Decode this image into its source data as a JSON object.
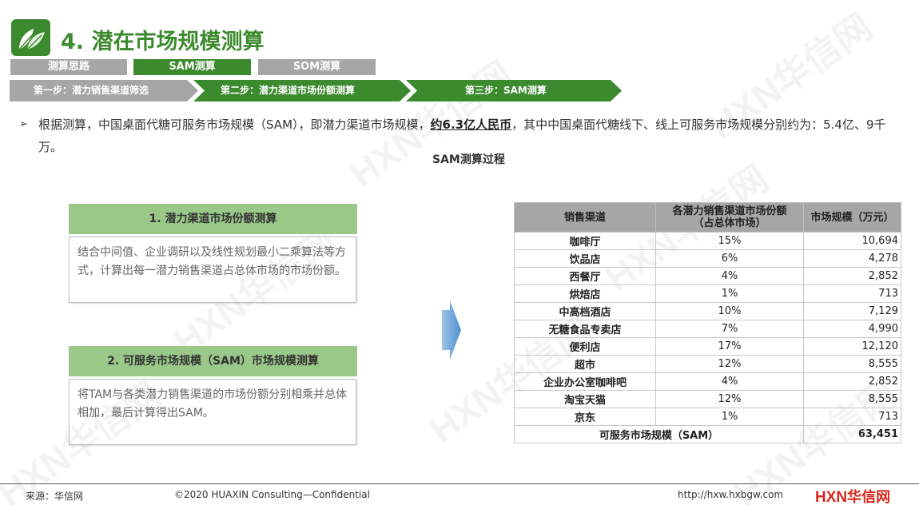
{
  "header": {
    "title": "4. 潜在市场规模测算",
    "tabs": [
      {
        "label": "测算思路",
        "active": false
      },
      {
        "label": "SAM测算",
        "active": true
      },
      {
        "label": "SOM测算",
        "active": false
      }
    ],
    "steps": [
      {
        "label": "第一步：潜力销售渠道筛选",
        "color": "#a6a6a6"
      },
      {
        "label": "第二步：潜力渠道市场份额测算",
        "color": "#3c8a2e"
      },
      {
        "label": "第三步：SAM测算",
        "color": "#3c8a2e"
      }
    ]
  },
  "summary": {
    "pre": "根据测算，中国桌面代糖可服务市场规模（SAM），即潜力渠道市场规模，",
    "highlight": "约6.3亿人民币",
    "post": "，其中中国桌面代糖线下、线上可服务市场规模分别约为：5.4亿、9千万。"
  },
  "process_title": "SAM测算过程",
  "boxes": [
    {
      "title": "1. 潜力渠道市场份额测算",
      "text": "结合中间值、企业调研以及线性规划最小二乘算法等方式，计算出每一潜力销售渠道占总体市场的市场份额。"
    },
    {
      "title": "2. 可服务市场规模（SAM）市场规模测算",
      "text": "将TAM与各类潜力销售渠道的市场份额分别相乘并总体相加，最后计算得出SAM。"
    }
  ],
  "table": {
    "headers": [
      "销售渠道",
      "各潜力销售渠道市场份额（占总体市场）",
      "市场规模（万元）"
    ],
    "rows": [
      [
        "咖啡厅",
        "15%",
        "10,694"
      ],
      [
        "饮品店",
        "6%",
        "4,278"
      ],
      [
        "西餐厅",
        "4%",
        "2,852"
      ],
      [
        "烘焙店",
        "1%",
        "713"
      ],
      [
        "中高档酒店",
        "10%",
        "7,129"
      ],
      [
        "无糖食品专卖店",
        "7%",
        "4,990"
      ],
      [
        "便利店",
        "17%",
        "12,120"
      ],
      [
        "超市",
        "12%",
        "8,555"
      ],
      [
        "企业办公室咖啡吧",
        "4%",
        "2,852"
      ],
      [
        "淘宝天猫",
        "12%",
        "8,555"
      ],
      [
        "京东",
        "1%",
        "713"
      ]
    ],
    "total_label": "可服务市场规模（SAM）",
    "total_value": "63,451"
  },
  "footer": {
    "source": "来源：华信网",
    "copyright": "©2020 HUAXIN Consulting—Confidential",
    "url": "http://hxw.hxbgw.com",
    "brand_prefix": "HXN",
    "brand_suffix": "华信网"
  },
  "watermark": "HXN华信网",
  "colors": {
    "brand_green": "#3c8a2e",
    "light_green": "#9ac888",
    "gray": "#a6a6a6",
    "brand_red": "#d9261c"
  }
}
